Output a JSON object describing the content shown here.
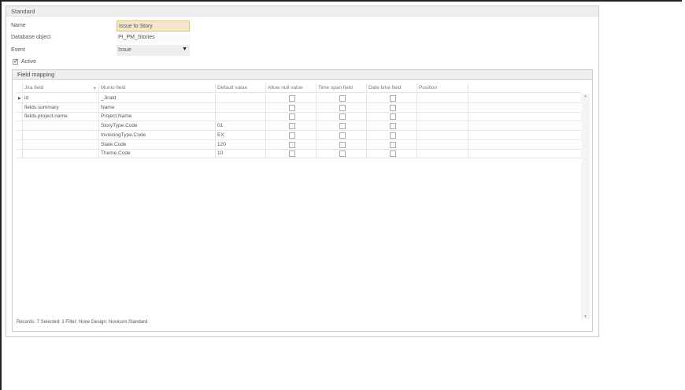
{
  "section_title": "Standard",
  "form": {
    "name_label": "Name",
    "name_value": "Issue to Story",
    "db_label": "Database object",
    "db_value": "PI_PM_Stories",
    "event_label": "Event",
    "event_value": "Issue",
    "active_label": "Active",
    "active_checked": true
  },
  "mapping": {
    "title": "Field mapping",
    "columns": [
      "Jira field",
      "Munio field",
      "Default value",
      "Allow null value",
      "Time span field",
      "Date time field",
      "Position"
    ],
    "rows": [
      {
        "jira": "id",
        "munio": "_JiraId",
        "default": ""
      },
      {
        "jira": "fields.summary",
        "munio": "Name",
        "default": ""
      },
      {
        "jira": "fields.project.name",
        "munio": "Project.Name",
        "default": ""
      },
      {
        "jira": "",
        "munio": "StoryType.Code",
        "default": "01"
      },
      {
        "jira": "",
        "munio": "InvoicingType.Code",
        "default": "EX"
      },
      {
        "jira": "",
        "munio": "State.Code",
        "default": "120"
      },
      {
        "jira": "",
        "munio": "Theme.Code",
        "default": "10"
      }
    ],
    "status": "Records: 7  Selected: 1  Filter: None  Design: Novicom.Standard"
  }
}
